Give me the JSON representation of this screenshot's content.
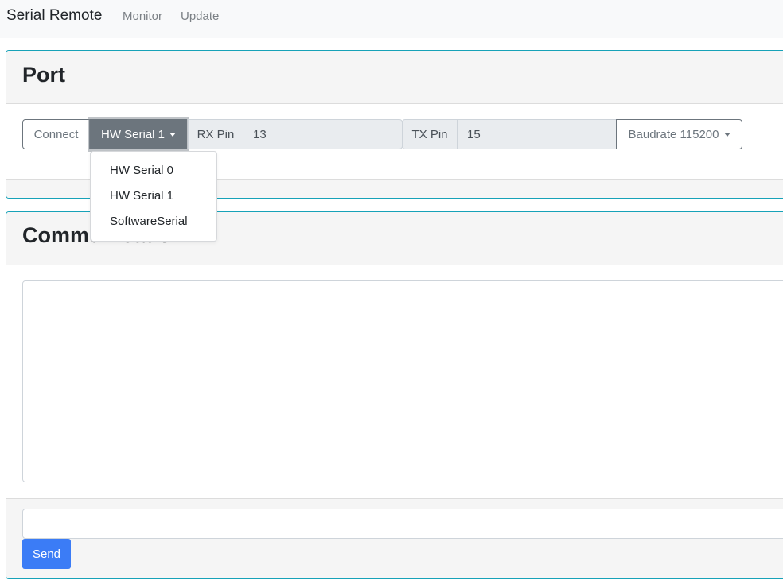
{
  "navbar": {
    "brand": "Serial Remote",
    "links": [
      "Monitor",
      "Update"
    ]
  },
  "port": {
    "title": "Port",
    "connect_label": "Connect",
    "serial_select": "HW Serial 1",
    "rx_label": "RX Pin",
    "rx_value": "13",
    "tx_label": "TX Pin",
    "tx_value": "15",
    "baudrate_label": "Baudrate 115200",
    "dropdown_items": [
      "HW Serial 0",
      "HW Serial 1",
      "SoftwareSerial"
    ]
  },
  "communication": {
    "title": "Communication",
    "log_text": "",
    "input_value": "",
    "send_label": "Send"
  },
  "colors": {
    "card_border": "#17a2b8",
    "primary": "#3b7cf6",
    "secondary": "#6c757d"
  }
}
